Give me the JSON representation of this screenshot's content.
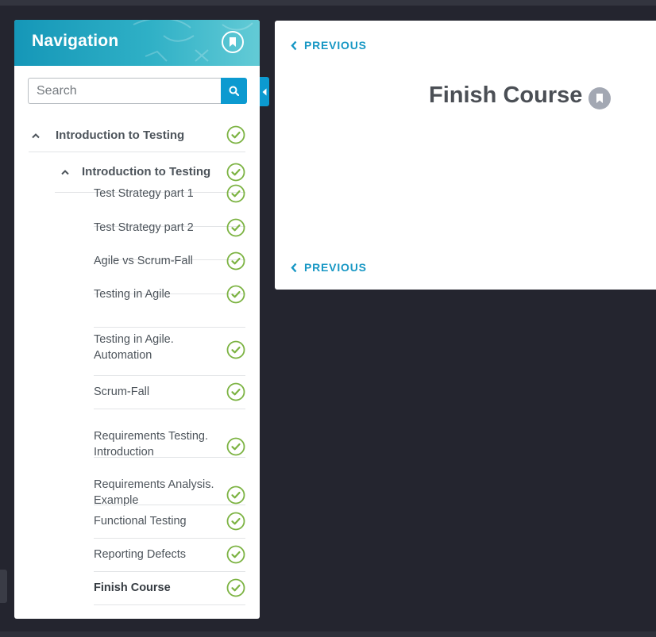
{
  "navigation": {
    "title": "Navigation",
    "search": {
      "placeholder": "Search",
      "value": ""
    },
    "module": {
      "label": "Introduction to Testing",
      "section": {
        "label": "Introduction to Testing",
        "items": [
          {
            "label": "Test Strategy part 1",
            "completed": true,
            "active": false
          },
          {
            "label": "Test Strategy part 2",
            "completed": true,
            "active": false
          },
          {
            "label": "Agile vs Scrum-Fall",
            "completed": true,
            "active": false
          },
          {
            "label": "Testing in Agile",
            "completed": true,
            "active": false
          },
          {
            "label": "Testing in Agile. Automation",
            "completed": true,
            "active": false
          },
          {
            "label": "Scrum-Fall",
            "completed": true,
            "active": false
          },
          {
            "label": "Requirements Testing. Introduction",
            "completed": true,
            "active": false
          },
          {
            "label": "Requirements Analysis. Example",
            "completed": true,
            "active": false
          },
          {
            "label": "Functional Testing",
            "completed": true,
            "active": false
          },
          {
            "label": "Reporting Defects",
            "completed": true,
            "active": false
          },
          {
            "label": "Finish Course",
            "completed": true,
            "active": true
          }
        ]
      }
    }
  },
  "content": {
    "previous_top": "PREVIOUS",
    "previous_bottom": "PREVIOUS",
    "title": "Finish Course"
  },
  "colors": {
    "accent": "#0c9ad0",
    "check": "#7cb342",
    "background": "#24252f"
  },
  "icons": {
    "bookmark": "bookmark-icon",
    "search": "search-icon",
    "check": "check-circle-icon",
    "chevron_up": "chevron-up-icon",
    "chevron_left": "chevron-left-icon",
    "collapse": "caret-left-icon"
  }
}
